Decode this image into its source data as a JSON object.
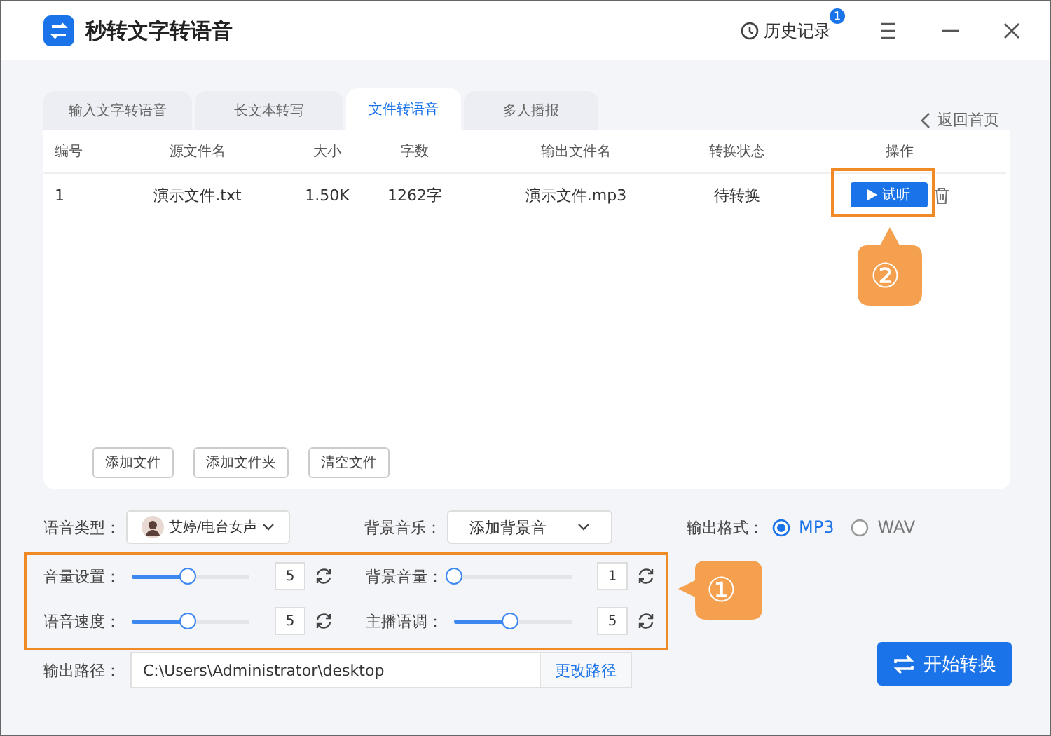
{
  "app": {
    "title": "秒转文字转语音"
  },
  "history": {
    "label": "历史记录",
    "badge": "1"
  },
  "tabs": [
    {
      "label": "输入文字转语音",
      "selected": false
    },
    {
      "label": "长文本转写",
      "selected": false
    },
    {
      "label": "文件转语音",
      "selected": true
    },
    {
      "label": "多人播报",
      "selected": false
    }
  ],
  "back_link": "返回首页",
  "table": {
    "columns": [
      "编号",
      "源文件名",
      "大小",
      "字数",
      "输出文件名",
      "转换状态",
      "操作"
    ],
    "rows": [
      {
        "cells": [
          "1",
          "演示文件.txt",
          "1.50K",
          "1262字",
          "演示文件.mp3",
          "待转换"
        ],
        "action": "试听"
      }
    ]
  },
  "file_buttons": [
    "添加文件",
    "添加文件夹",
    "清空文件"
  ],
  "voice_type": {
    "label": "语音类型：",
    "value": "艾婷/电台女声"
  },
  "background_music": {
    "label": "背景音乐：",
    "value": "添加背景音"
  },
  "output_format": {
    "label": "输出格式：",
    "options": [
      {
        "label": "MP3",
        "selected": true
      },
      {
        "label": "WAV",
        "selected": false
      }
    ]
  },
  "sliders": [
    {
      "label": "音量设置：",
      "level": 0.48,
      "value": "5"
    },
    {
      "label": "背景音量：",
      "level": 0,
      "value": "1"
    },
    {
      "label": "语音速度：",
      "level": 0.48,
      "value": "5"
    },
    {
      "label": "主播语调：",
      "level": 0.48,
      "value": "5"
    }
  ],
  "output_path": {
    "label": "输出路径：",
    "value": "C:\\Users\\Administrator\\desktop",
    "change": "更改路径"
  },
  "start_button": "开始转换",
  "annotations": [
    {
      "mark": "①"
    },
    {
      "mark": "②"
    }
  ]
}
